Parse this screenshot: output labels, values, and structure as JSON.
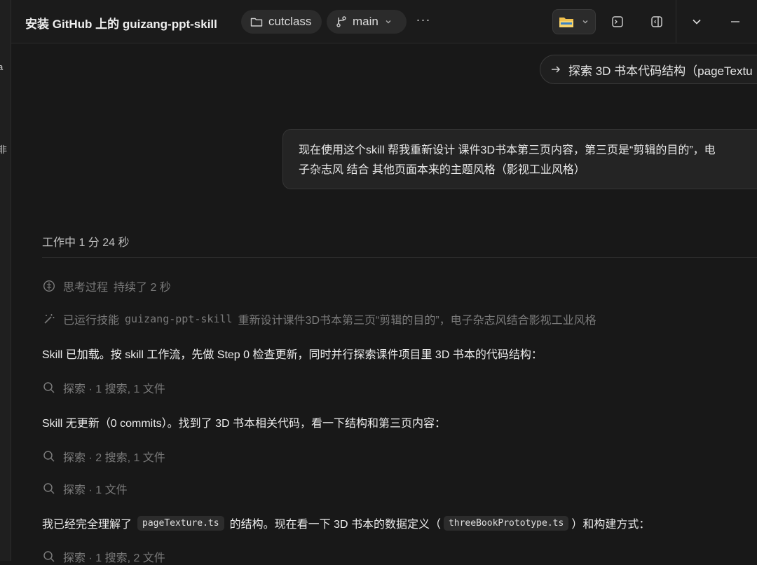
{
  "left_strip": {
    "fragments": [
      "a",
      "非"
    ]
  },
  "titlebar": {
    "title": "安装 GitHub 上的 guizang-ppt-skill",
    "project": "cutclass",
    "branch": "main",
    "more": "···"
  },
  "task_chip": {
    "text": "探索 3D 书本代码结构（pageTextu"
  },
  "user_message": {
    "line1": "现在使用这个skill  帮我重新设计 课件3D书本第三页内容，第三页是“剪辑的目的”，电",
    "line2": "子杂志风 结合 其他页面本来的主题风格（影视工业风格）"
  },
  "status": {
    "working": "工作中 1 分 24 秒"
  },
  "timeline": {
    "thinking": {
      "label": "思考过程",
      "duration": "持续了 2 秒"
    },
    "skill_run": {
      "label": "已运行技能",
      "skill": "guizang-ppt-skill",
      "desc": "重新设计课件3D书本第三页“剪辑的目的”，电子杂志风结合影视工业风格"
    },
    "msg1": "Skill 已加载。按 skill 工作流，先做 Step 0 检查更新，同时并行探索课件项目里 3D 书本的代码结构：",
    "explore1": "探索 · 1 搜索, 1 文件",
    "msg2": "Skill 无更新（0 commits）。找到了 3D 书本相关代码，看一下结构和第三页内容：",
    "explore2": "探索 · 2 搜索, 1 文件",
    "explore3": "探索 · 1 文件",
    "msg3": {
      "before": "我已经完全理解了",
      "code1": "pageTexture.ts",
      "middle": "的结构。现在看一下 3D 书本的数据定义（",
      "code2": "threeBookPrototype.ts",
      "after": "）和构建方式："
    },
    "explore4": "探索 · 1 搜索, 2 文件"
  },
  "colors": {
    "background": "#181818",
    "folder_icon": "#f2c14e",
    "muted_text": "#7a7a7a"
  }
}
